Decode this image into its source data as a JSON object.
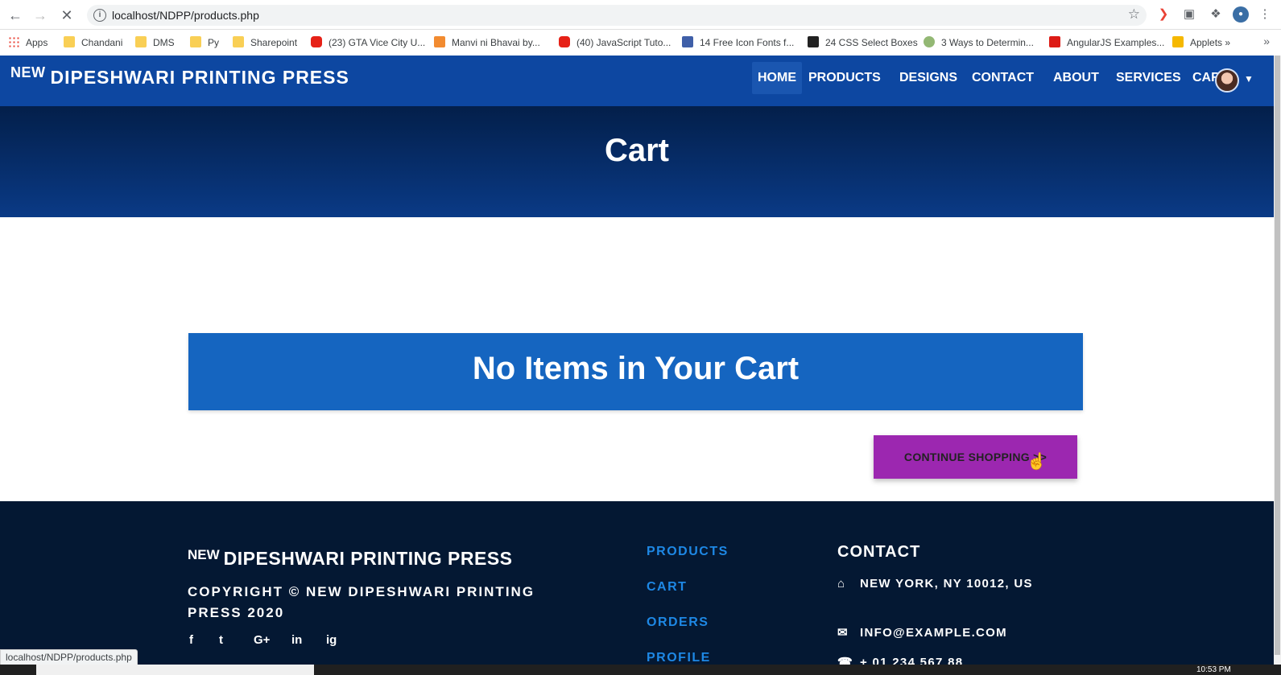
{
  "browser": {
    "url": "localhost/NDPP/products.php",
    "status_url": "localhost/NDPP/products.php"
  },
  "bookmarks": [
    {
      "label": "Apps",
      "icon": "apps-grid-icon"
    },
    {
      "label": "Chandani",
      "icon": "folder-icon"
    },
    {
      "label": "DMS",
      "icon": "folder-icon"
    },
    {
      "label": "Py",
      "icon": "folder-icon"
    },
    {
      "label": "Sharepoint",
      "icon": "folder-icon"
    },
    {
      "label": "(23) GTA Vice City U...",
      "icon": "youtube-icon"
    },
    {
      "label": "Manvi ni Bhavai by...",
      "icon": "site-icon"
    },
    {
      "label": "(40) JavaScript Tuto...",
      "icon": "youtube-icon"
    },
    {
      "label": "14 Free Icon Fonts f...",
      "icon": "fx-icon"
    },
    {
      "label": "24 CSS Select Boxes",
      "icon": "f-icon"
    },
    {
      "label": "3 Ways to Determin...",
      "icon": "wikihow-icon"
    },
    {
      "label": "AngularJS Examples...",
      "icon": "site-icon"
    },
    {
      "label": "Applets »",
      "icon": "h-icon"
    }
  ],
  "site": {
    "brand_new": "NEW",
    "brand_name": "DIPESHWARI PRINTING PRESS",
    "menu": [
      "HOME",
      "PRODUCTS",
      "DESIGNS",
      "CONTACT",
      "ABOUT",
      "SERVICES",
      "CART"
    ]
  },
  "hero": {
    "title": "Cart"
  },
  "cart": {
    "empty_message": "No Items in Your Cart",
    "continue_label": "CONTINUE SHOPPING >>"
  },
  "footer": {
    "brand_new": "NEW",
    "brand_name": "DIPESHWARI PRINTING PRESS",
    "copyright": "COPYRIGHT © NEW DIPESHWARI PRINTING PRESS 2020",
    "social": [
      "f",
      "t",
      "G+",
      "in",
      "ig"
    ],
    "links": [
      "PRODUCTS",
      "CART",
      "ORDERS",
      "PROFILE"
    ],
    "contact_title": "CONTACT",
    "address": "NEW YORK, NY 10012, US",
    "email": "INFO@EXAMPLE.COM",
    "phone": "+ 01 234 567 88"
  },
  "taskbar": {
    "time": "10:53 PM"
  },
  "colors": {
    "nav": "#0d47a1",
    "box": "#1565c0",
    "button": "#9c27b0",
    "footer": "#041833",
    "link": "#1e88e5"
  }
}
